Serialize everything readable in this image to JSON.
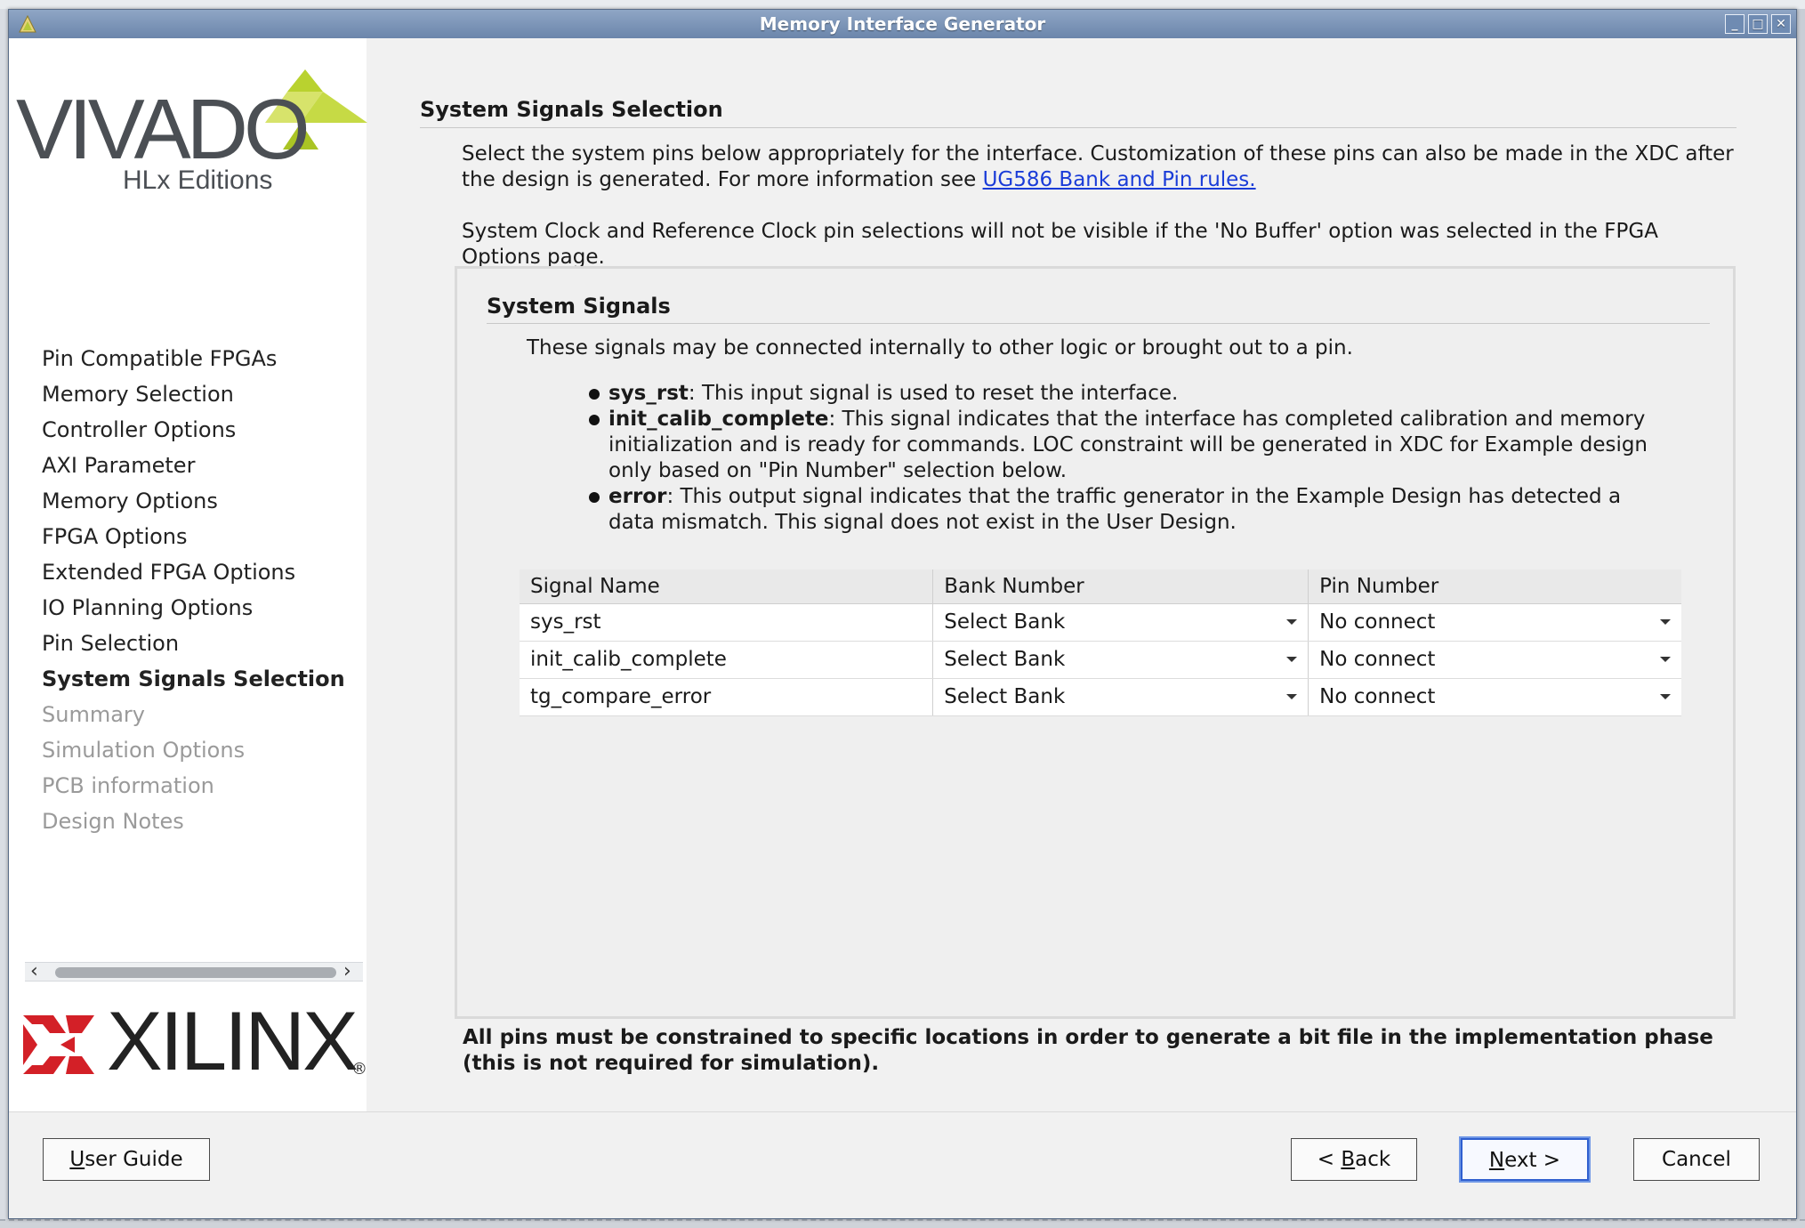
{
  "window": {
    "title": "Memory Interface Generator",
    "controls": [
      "_",
      "□",
      "✕"
    ]
  },
  "sidebar": {
    "logo_word": "VIVADO",
    "logo_sub": "HLx Editions",
    "steps": [
      {
        "label": "Pin Compatible FPGAs",
        "state": "done"
      },
      {
        "label": "Memory Selection",
        "state": "done"
      },
      {
        "label": "Controller Options",
        "state": "done"
      },
      {
        "label": "AXI Parameter",
        "state": "done"
      },
      {
        "label": "Memory Options",
        "state": "done"
      },
      {
        "label": "FPGA Options",
        "state": "done"
      },
      {
        "label": "Extended FPGA Options",
        "state": "done"
      },
      {
        "label": "IO Planning Options",
        "state": "done"
      },
      {
        "label": "Pin Selection",
        "state": "done"
      },
      {
        "label": "System Signals Selection",
        "state": "current"
      },
      {
        "label": "Summary",
        "state": "future"
      },
      {
        "label": "Simulation Options",
        "state": "future"
      },
      {
        "label": "PCB information",
        "state": "future"
      },
      {
        "label": "Design Notes",
        "state": "future"
      }
    ],
    "vendor_word": "XILINX",
    "vendor_reg": "®"
  },
  "main": {
    "section_title": "System Signals Selection",
    "intro_1_text": "Select the system pins below appropriately for the interface. Customization of these pins can also be made in the XDC after the design is generated. For more information see ",
    "intro_1_link": "UG586 Bank and Pin rules.",
    "intro_2": "System Clock and Reference Clock pin selections will not be visible if the 'No Buffer' option was selected in the FPGA Options page.",
    "group_title": "System Signals",
    "group_desc": "These signals may be connected internally to other logic or brought out to a pin.",
    "bullets": [
      {
        "term": "sys_rst",
        "text": ": This input signal is used to reset the interface."
      },
      {
        "term": "init_calib_complete",
        "text": ": This signal indicates that the interface has completed calibration and memory initialization and is ready for commands. LOC constraint will be generated in XDC for Example design only based on \"Pin Number\" selection below."
      },
      {
        "term": "error",
        "text": ": This output signal indicates that the traffic generator in the Example Design has detected a data mismatch. This signal does not exist in the User Design."
      }
    ],
    "table": {
      "columns": [
        "Signal Name",
        "Bank Number",
        "Pin Number"
      ],
      "rows": [
        {
          "signal": "sys_rst",
          "bank": "Select Bank",
          "pin": "No connect"
        },
        {
          "signal": "init_calib_complete",
          "bank": "Select Bank",
          "pin": "No connect"
        },
        {
          "signal": "tg_compare_error",
          "bank": "Select Bank",
          "pin": "No connect"
        }
      ]
    },
    "footnote": "All pins must be constrained to specific locations in order to generate a bit file in the implementation phase (this is not required for simulation)."
  },
  "buttons": {
    "user_guide": {
      "mnemonic": "U",
      "rest": "ser Guide"
    },
    "back": {
      "prefix": "< ",
      "mnemonic": "B",
      "rest": "ack"
    },
    "next": {
      "mnemonic": "N",
      "rest": "ext >"
    },
    "cancel": "Cancel"
  },
  "colors": {
    "titlebar": "#6b86ab",
    "link": "#1a3cd8",
    "vivado_green": "#b9d22f",
    "xilinx_red": "#d32027",
    "default_button_border": "#2f5fcf"
  }
}
